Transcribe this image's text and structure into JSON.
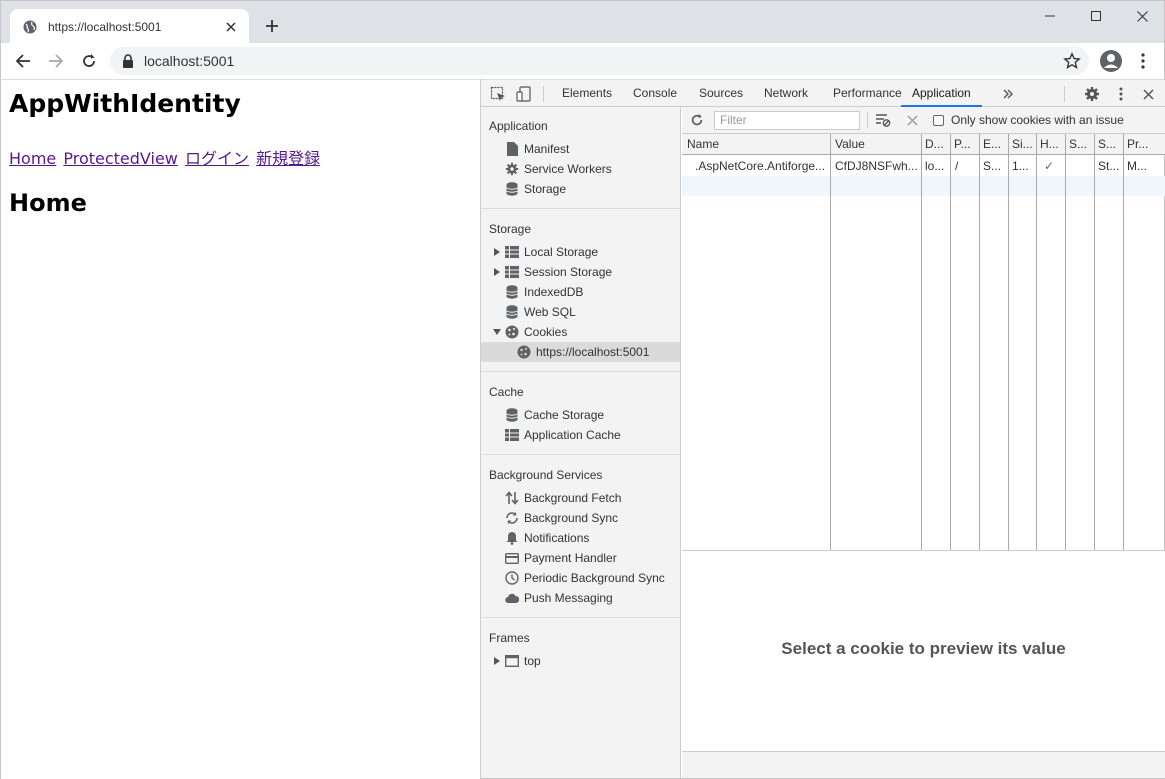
{
  "browser": {
    "tab_title": "https://localhost:5001",
    "url": "localhost:5001"
  },
  "page": {
    "heading": "AppWithIdentity",
    "nav": [
      "Home",
      "ProtectedView",
      "ログイン",
      "新規登録"
    ],
    "subheading": "Home"
  },
  "devtools": {
    "tabs": [
      "Elements",
      "Console",
      "Sources",
      "Network",
      "Performance",
      "Application"
    ],
    "active_tab": "Application",
    "sidebar": {
      "application_section": "Application",
      "application_items": [
        "Manifest",
        "Service Workers",
        "Storage"
      ],
      "storage_section": "Storage",
      "storage_items": [
        "Local Storage",
        "Session Storage",
        "IndexedDB",
        "Web SQL",
        "Cookies"
      ],
      "cookies_child": "https://localhost:5001",
      "cache_section": "Cache",
      "cache_items": [
        "Cache Storage",
        "Application Cache"
      ],
      "bg_section": "Background Services",
      "bg_items": [
        "Background Fetch",
        "Background Sync",
        "Notifications",
        "Payment Handler",
        "Periodic Background Sync",
        "Push Messaging"
      ],
      "frames_section": "Frames",
      "frames_items": [
        "top"
      ]
    },
    "cookie_toolbar": {
      "filter_placeholder": "Filter",
      "only_issues_label": "Only show cookies with an issue"
    },
    "cookie_table": {
      "headers": [
        "Name",
        "Value",
        "D...",
        "P...",
        "E...",
        "Si...",
        "H...",
        "S...",
        "S...",
        "Pr..."
      ],
      "rows": [
        [
          ".AspNetCore.Antiforge...",
          "CfDJ8NSFwh...",
          "lo...",
          "/",
          "S...",
          "1...",
          "✓",
          "",
          "St...",
          "M..."
        ]
      ]
    },
    "preview_message": "Select a cookie to preview its value"
  }
}
